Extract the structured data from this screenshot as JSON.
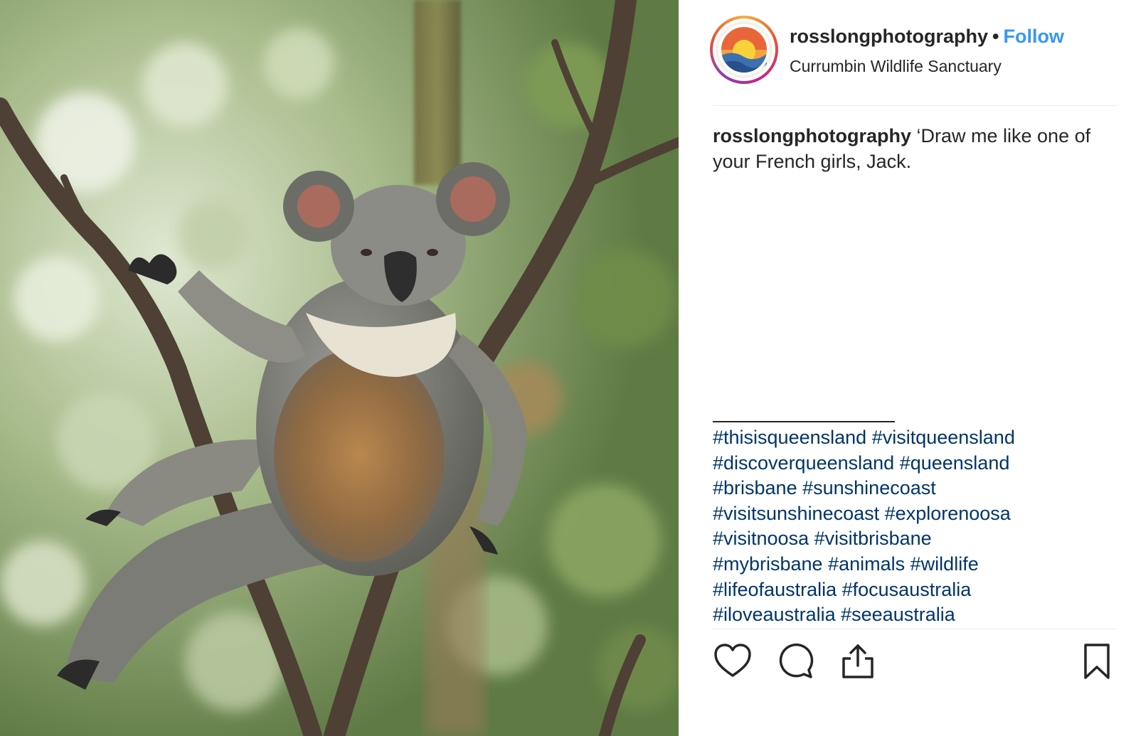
{
  "post": {
    "username": "rosslongphotography",
    "separator": "•",
    "follow_label": "Follow",
    "location": "Currumbin Wildlife Sanctuary",
    "caption": {
      "username": "rosslongphotography",
      "text": "‘Draw me like one of your French girls, Jack."
    },
    "hashtags": [
      "#thisisqueensland",
      "#visitqueensland",
      "#discoverqueensland",
      "#queensland",
      "#brisbane",
      "#sunshinecoast",
      "#visitsunshinecoast",
      "#explorenoosa",
      "#visitnoosa",
      "#visitbrisbane",
      "#mybrisbane",
      "#animals",
      "#wildlife",
      "#lifeofaustralia",
      "#focusaustralia",
      "#iloveaustralia",
      "#seeaustralia"
    ]
  },
  "icons": {
    "like": "heart-icon",
    "comment": "comment-bubble-icon",
    "share": "share-upload-icon",
    "save": "bookmark-icon"
  },
  "colors": {
    "follow": "#3897f0",
    "hashtag": "#003569",
    "text": "#262626",
    "divider": "#ececec"
  }
}
